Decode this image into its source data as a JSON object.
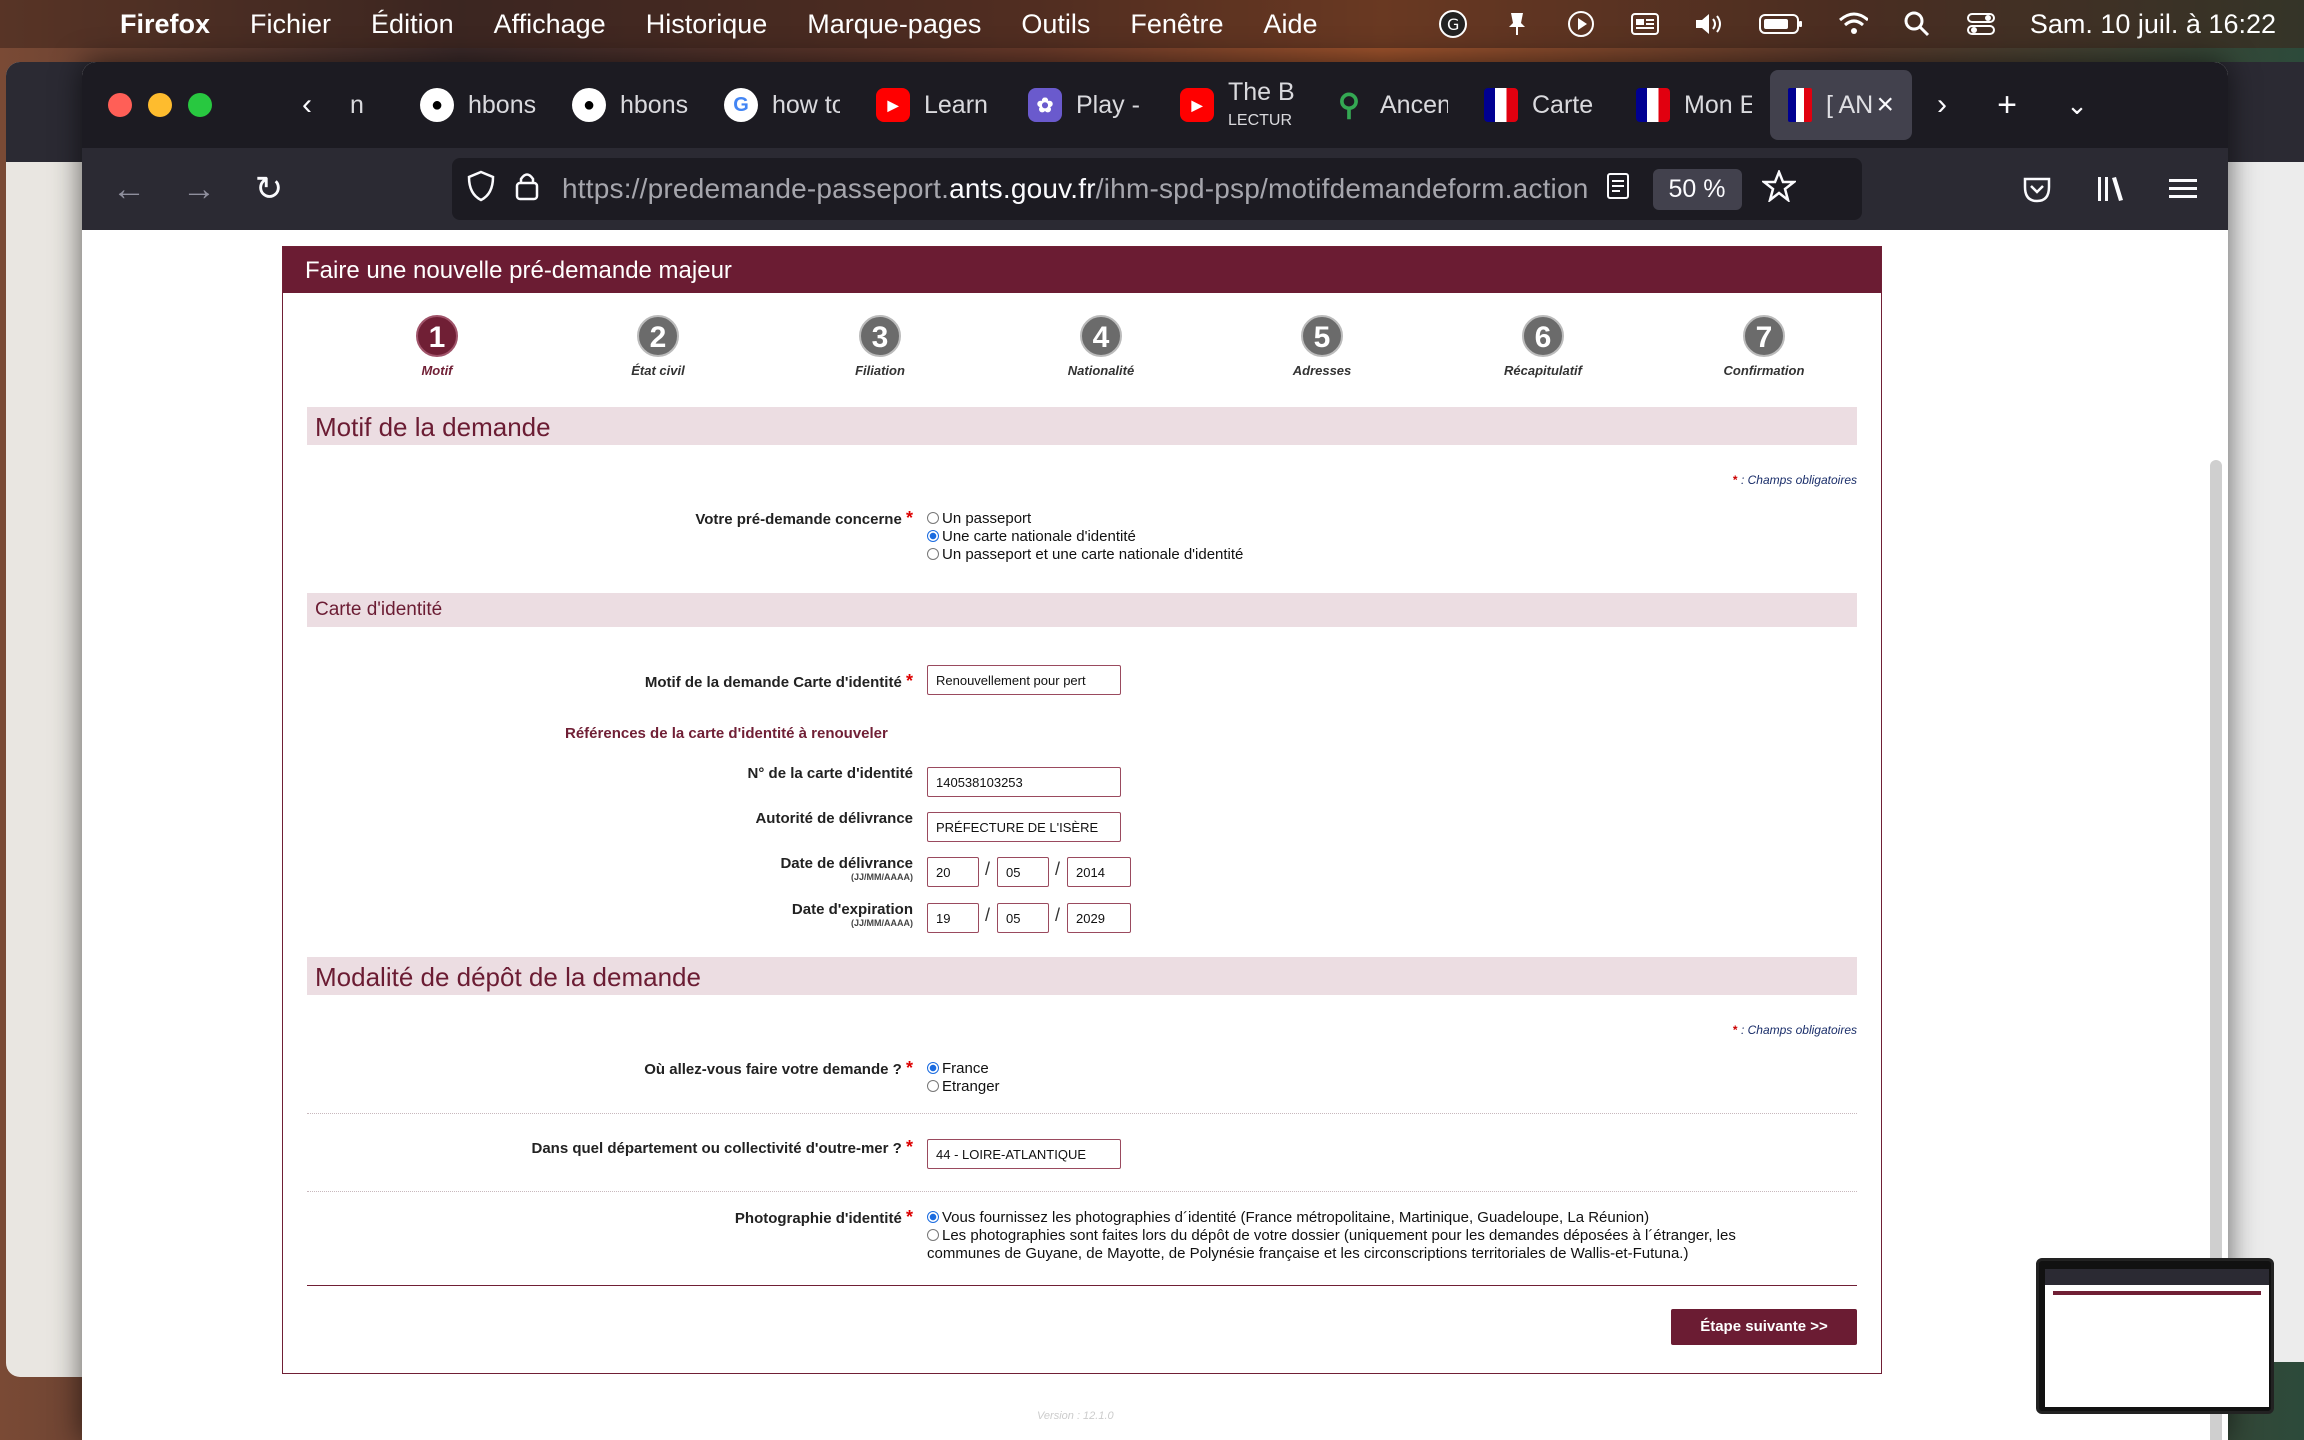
{
  "menubar": {
    "app": "Firefox",
    "items": [
      "Fichier",
      "Édition",
      "Affichage",
      "Historique",
      "Marque-pages",
      "Outils",
      "Fenêtre",
      "Aide"
    ],
    "clock": "Sam. 10 juil. à  16:22"
  },
  "tabs": [
    {
      "title": "n",
      "icon": "generic-icon"
    },
    {
      "title": "hbons",
      "icon": "github-icon"
    },
    {
      "title": "hbons",
      "icon": "github-icon"
    },
    {
      "title": "how to",
      "icon": "google-icon"
    },
    {
      "title": "Learn",
      "icon": "youtube-icon"
    },
    {
      "title": "Play -",
      "icon": "play-icon"
    },
    {
      "title": "The B",
      "icon": "youtube-icon",
      "subtitle": "LECTUR"
    },
    {
      "title": "Ancen",
      "icon": "maps-pin-icon"
    },
    {
      "title": "Carte",
      "icon": "marianne-icon"
    },
    {
      "title": "Mon E",
      "icon": "marianne-icon"
    },
    {
      "title": "[ AN",
      "icon": "france-flag-icon",
      "active": true
    }
  ],
  "url": {
    "prefix": "https://predemande-passeport.",
    "domain": "ants.gouv.fr",
    "path": "/ihm-spd-psp/motifdemandeform.action"
  },
  "zoom": "50 %",
  "form": {
    "title": "Faire une nouvelle pré-demande majeur",
    "steps": [
      {
        "num": "1",
        "label": "Motif",
        "active": true
      },
      {
        "num": "2",
        "label": "État civil"
      },
      {
        "num": "3",
        "label": "Filiation"
      },
      {
        "num": "4",
        "label": "Nationalité"
      },
      {
        "num": "5",
        "label": "Adresses"
      },
      {
        "num": "6",
        "label": "Récapitulatif"
      },
      {
        "num": "7",
        "label": "Confirmation"
      }
    ],
    "section1": "Motif de la demande",
    "required_note": ": Champs obligatoires",
    "required_star": "*",
    "q_concerne": "Votre pré-demande concerne",
    "concerne_options": [
      "Un passeport",
      "Une carte nationale d'identité",
      "Un passeport et une carte nationale d'identité"
    ],
    "concerne_selected": 1,
    "section_cni": "Carte d'identité",
    "motif_label": "Motif de la demande Carte d'identité",
    "motif_value": "Renouvellement pour pert",
    "refs_heading": "Références de la carte d'identité à renouveler",
    "num_label": "N° de la carte d'identité",
    "num_value": "140538103253",
    "autorite_label": "Autorité de délivrance",
    "autorite_value": "PRÉFECTURE DE L'ISÈRE",
    "date_deliv_label": "Date de délivrance",
    "date_format": "(JJ/MM/AAAA)",
    "date_deliv": {
      "dd": "20",
      "mm": "05",
      "yyyy": "2014"
    },
    "date_exp_label": "Date d'expiration",
    "date_exp": {
      "dd": "19",
      "mm": "05",
      "yyyy": "2029"
    },
    "date_sep": "/",
    "section2": "Modalité de dépôt de la demande",
    "q_ou": "Où allez-vous faire votre demande ?",
    "ou_options": [
      "France",
      "Etranger"
    ],
    "ou_selected": 0,
    "q_departement": "Dans quel département ou collectivité d'outre-mer ?",
    "departement_value": "44 - LOIRE-ATLANTIQUE",
    "q_photo": "Photographie d'identité",
    "photo_options": [
      "Vous fournissez les photographies d´identité (France métropolitaine, Martinique, Guadeloupe, La Réunion)",
      "Les photographies sont faites lors du dépôt de votre dossier (uniquement pour les demandes déposées à l´étranger, les",
      "communes de Guyane, de Mayotte, de Polynésie française et les circonscriptions territoriales de Wallis-et-Futuna.)"
    ],
    "next_button": "Étape suivante  >>",
    "version": "Version : 12.1.0"
  },
  "colors": {
    "brand": "#6b1c33",
    "section_bg": "#ecdde2",
    "required": "#dd0000"
  }
}
